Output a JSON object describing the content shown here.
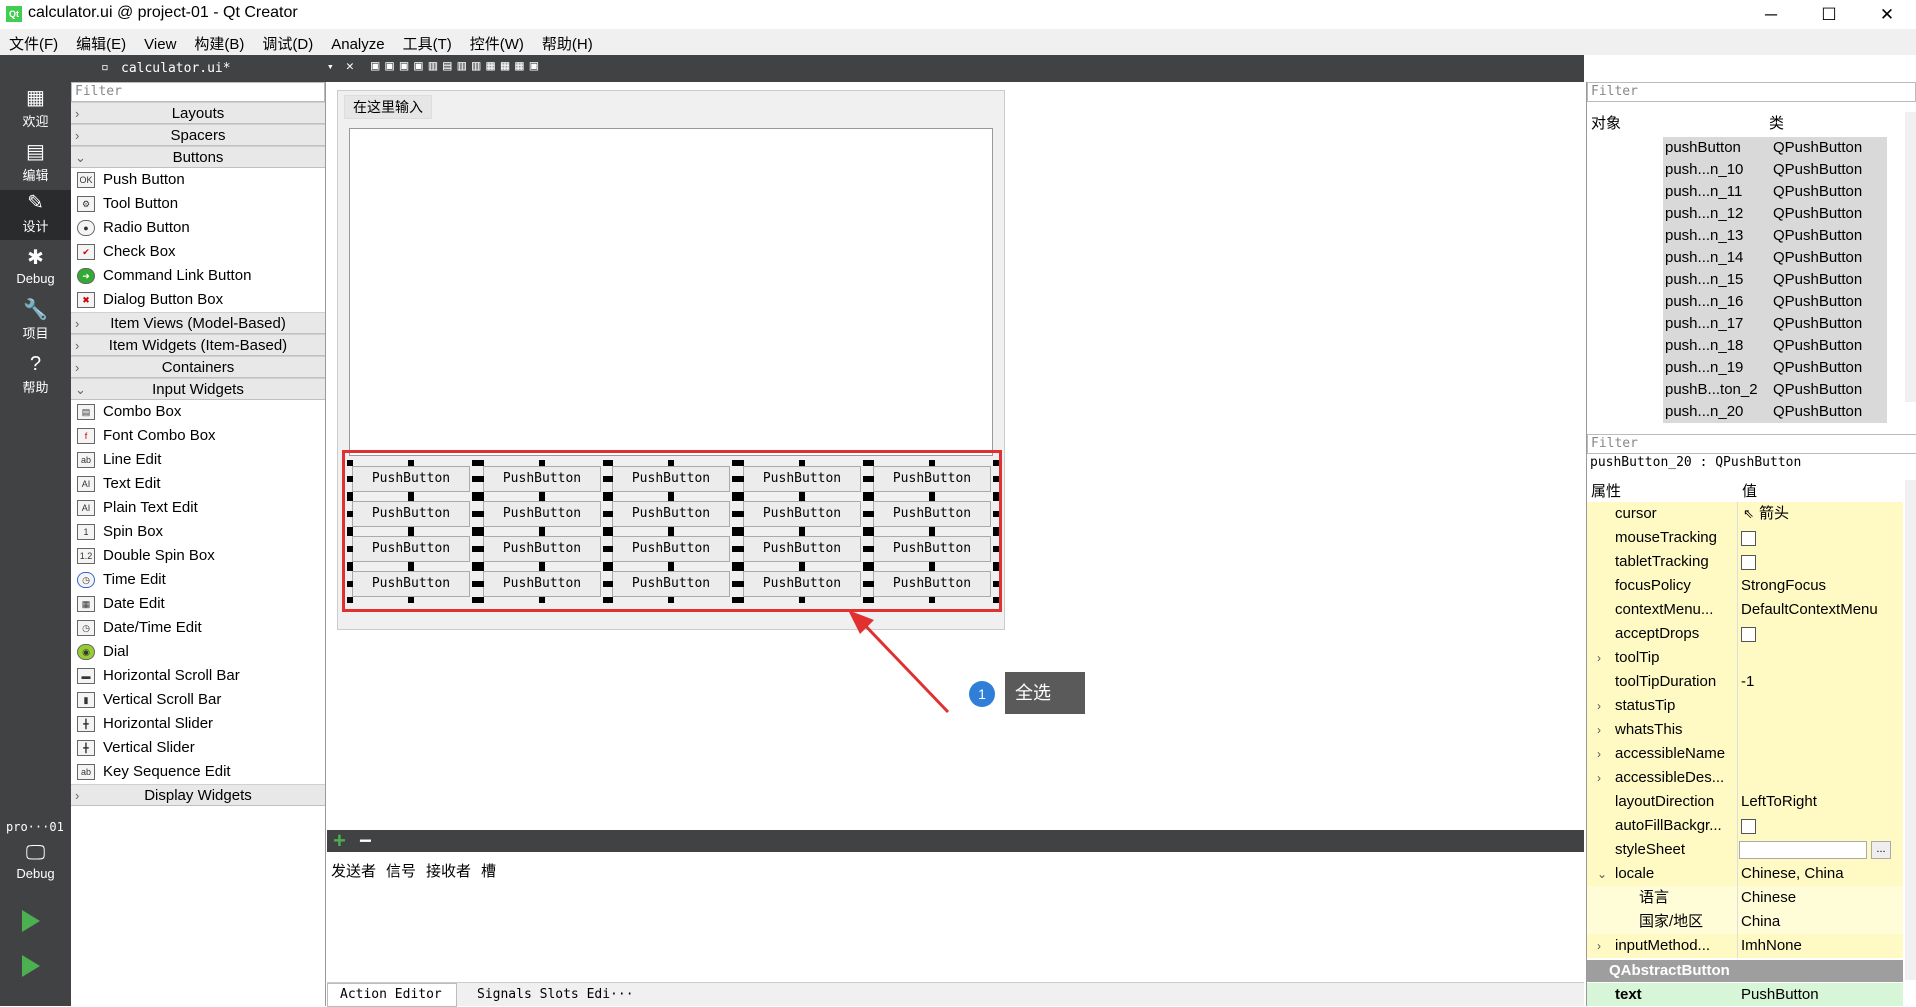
{
  "window": {
    "title": "calculator.ui @ project-01 - Qt Creator",
    "app_icon": "Qt",
    "minimize": "─",
    "maximize": "☐",
    "close": "✕"
  },
  "menu": [
    "文件(F)",
    "编辑(E)",
    "View",
    "构建(B)",
    "调试(D)",
    "Analyze",
    "工具(T)",
    "控件(W)",
    "帮助(H)"
  ],
  "modes": [
    {
      "label": "欢迎",
      "icon": "grid-icon"
    },
    {
      "label": "编辑",
      "icon": "document-icon"
    },
    {
      "label": "设计",
      "icon": "pencil-icon"
    },
    {
      "label": "Debug",
      "icon": "bug-icon"
    },
    {
      "label": "项目",
      "icon": "wrench-icon"
    },
    {
      "label": "帮助",
      "icon": "help-icon"
    }
  ],
  "kit": {
    "project": "pro···01",
    "label": "Debug"
  },
  "doc_tab": "calculator.ui*",
  "widget_box": {
    "filter_placeholder": "Filter",
    "categories_top": [
      "Layouts",
      "Spacers",
      "Buttons"
    ],
    "buttons": [
      "Push Button",
      "Tool Button",
      "Radio Button",
      "Check Box",
      "Command Link Button",
      "Dialog Button Box"
    ],
    "categories_mid": [
      "Item Views (Model-Based)",
      "Item Widgets (Item-Based)",
      "Containers",
      "Input Widgets"
    ],
    "inputs": [
      "Combo Box",
      "Font Combo Box",
      "Line Edit",
      "Text Edit",
      "Plain Text Edit",
      "Spin Box",
      "Double Spin Box",
      "Time Edit",
      "Date Edit",
      "Date/Time Edit",
      "Dial",
      "Horizontal Scroll Bar",
      "Vertical Scroll Bar",
      "Horizontal Slider",
      "Vertical Slider",
      "Key Sequence Edit"
    ],
    "category_last": "Display Widgets"
  },
  "form": {
    "title": "在这里输入",
    "button_label": "PushButton"
  },
  "callout": {
    "number": "1",
    "text": "全选"
  },
  "signal_panel": {
    "columns": [
      "发送者",
      "信号",
      "接收者",
      "槽"
    ],
    "tabs": [
      "Action Editor",
      "Signals Slots Edi···"
    ]
  },
  "object_inspector": {
    "filter_placeholder": "Filter",
    "col_object": "对象",
    "col_class": "类",
    "rows": [
      [
        "pushButton",
        "QPushButton"
      ],
      [
        "push...n_10",
        "QPushButton"
      ],
      [
        "push...n_11",
        "QPushButton"
      ],
      [
        "push...n_12",
        "QPushButton"
      ],
      [
        "push...n_13",
        "QPushButton"
      ],
      [
        "push...n_14",
        "QPushButton"
      ],
      [
        "push...n_15",
        "QPushButton"
      ],
      [
        "push...n_16",
        "QPushButton"
      ],
      [
        "push...n_17",
        "QPushButton"
      ],
      [
        "push...n_18",
        "QPushButton"
      ],
      [
        "push...n_19",
        "QPushButton"
      ],
      [
        "pushB...ton_2",
        "QPushButton"
      ],
      [
        "push...n_20",
        "QPushButton"
      ]
    ]
  },
  "property_editor": {
    "filter_placeholder": "Filter",
    "current": "pushButton_20 : QPushButton",
    "col_prop": "属性",
    "col_value": "值",
    "rows": [
      {
        "name": "cursor",
        "value": "箭头",
        "icon": "arrow-cursor-icon"
      },
      {
        "name": "mouseTracking",
        "check": true
      },
      {
        "name": "tabletTracking",
        "check": true
      },
      {
        "name": "focusPolicy",
        "value": "StrongFocus"
      },
      {
        "name": "contextMenu...",
        "value": "DefaultContextMenu"
      },
      {
        "name": "acceptDrops",
        "check": true
      },
      {
        "name": "toolTip",
        "value": "",
        "expand": true
      },
      {
        "name": "toolTipDuration",
        "value": "-1"
      },
      {
        "name": "statusTip",
        "value": "",
        "expand": true
      },
      {
        "name": "whatsThis",
        "value": "",
        "expand": true
      },
      {
        "name": "accessibleName",
        "value": "",
        "expand": true
      },
      {
        "name": "accessibleDes...",
        "value": "",
        "expand": true
      },
      {
        "name": "layoutDirection",
        "value": "LeftToRight"
      },
      {
        "name": "autoFillBackgr...",
        "check": true
      },
      {
        "name": "styleSheet",
        "value": "",
        "edit": true
      },
      {
        "name": "locale",
        "value": "Chinese, China",
        "open": true
      },
      {
        "name": "语言",
        "value": "Chinese",
        "indent": true
      },
      {
        "name": "国家/地区",
        "value": "China",
        "indent": true
      },
      {
        "name": "inputMethod...",
        "value": "ImhNone",
        "expand": true
      }
    ],
    "section": "QAbstractButton",
    "text_row": {
      "name": "text",
      "value": "PushButton"
    }
  }
}
